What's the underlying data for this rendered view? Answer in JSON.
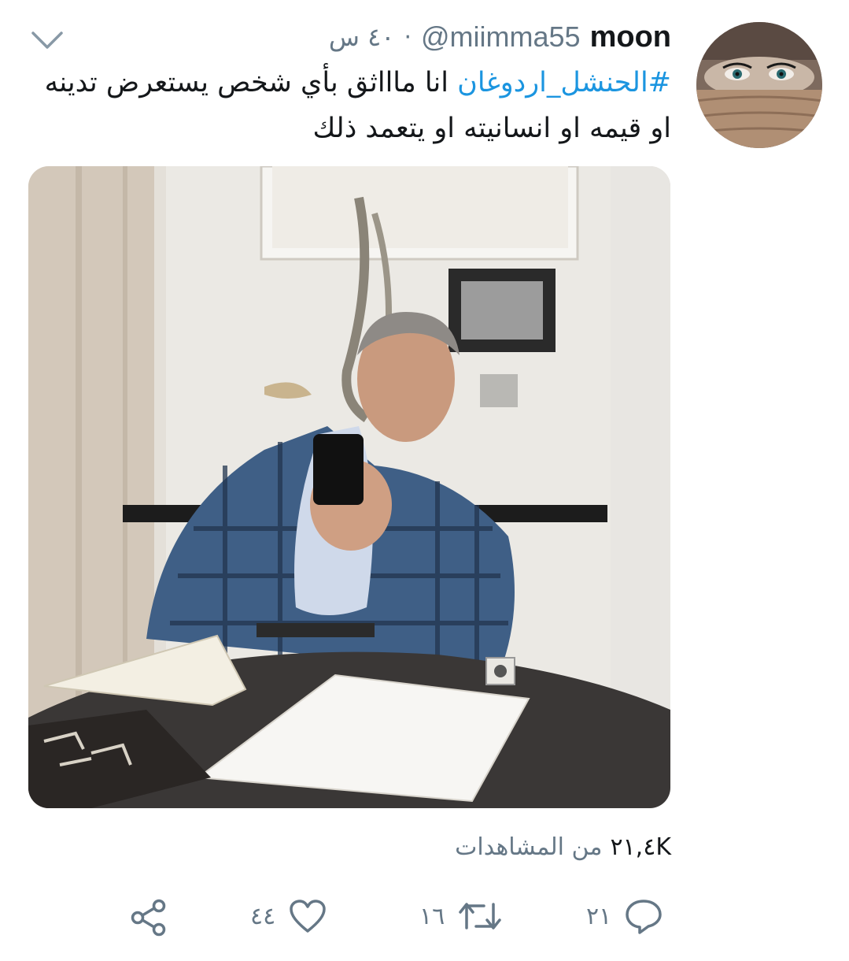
{
  "tweet": {
    "display_name": "moon",
    "handle": "@miimma55",
    "separator": "·",
    "time": "٤٠ س",
    "hashtag": "#الحنشل_اردوغان",
    "text": " انا ماااثق بأي شخص يستعرض تدينه او قيمه او انسانيته او يتعمد ذلك",
    "views_count": "٢١,٤K",
    "views_label": "من المشاهدات"
  },
  "actions": {
    "reply_count": "٢١",
    "retweet_count": "١٦",
    "like_count": "٤٤"
  },
  "icons": {
    "caret": "chevron-down-icon",
    "reply": "reply-icon",
    "retweet": "retweet-icon",
    "like": "heart-icon",
    "share": "share-icon"
  },
  "colors": {
    "hashtag": "#1b95e0",
    "secondary_text": "#657786",
    "primary_text": "#14171a"
  }
}
